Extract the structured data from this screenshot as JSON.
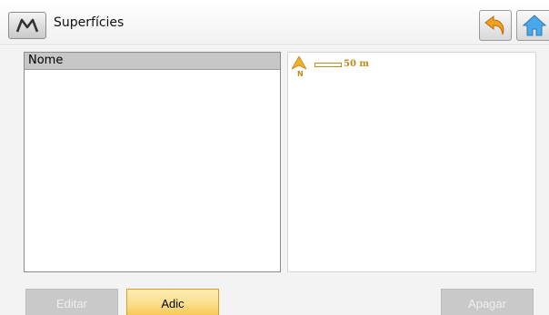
{
  "header": {
    "title": "Superfícies",
    "menu_icon": "m-logo-icon",
    "back_icon": "undo-arrow-icon",
    "home_icon": "home-icon"
  },
  "list": {
    "column_header": "Nome",
    "rows": []
  },
  "map": {
    "north_label": "N",
    "scale_label": "50 m",
    "accent_color": "#c28a16"
  },
  "buttons": {
    "edit_label": "Editar",
    "add_label": "Adic",
    "delete_label": "Apagar"
  },
  "colors": {
    "button_active": "#fbe08d",
    "button_disabled": "#c9c9c9"
  }
}
